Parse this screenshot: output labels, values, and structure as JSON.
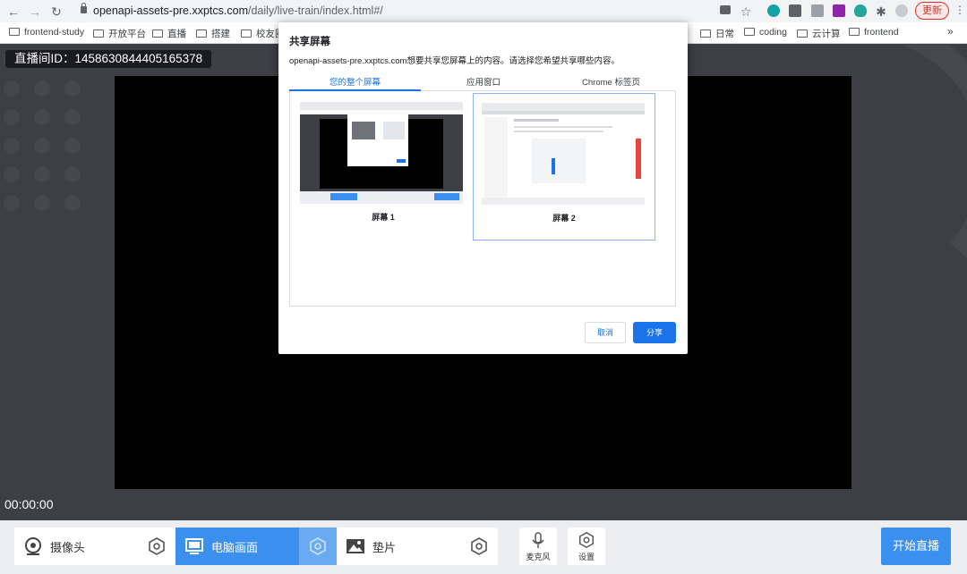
{
  "browser": {
    "url_host": "openapi-assets-pre.xxptcs.com",
    "url_path": "/daily/live-train/index.html#/",
    "update_label": "更新",
    "menu_glyph": "⋮"
  },
  "bookmarks": [
    {
      "label": "frontend-study"
    },
    {
      "label": "开放平台"
    },
    {
      "label": "直播"
    },
    {
      "label": "搭建"
    },
    {
      "label": "校友圈"
    },
    {
      "label": "日常"
    },
    {
      "label": "coding"
    },
    {
      "label": "云计算"
    },
    {
      "label": "frontend"
    }
  ],
  "bookmarks_overflow": "»",
  "page": {
    "room_id": "直播间ID：1458630844405165378",
    "timer": "00:00:00"
  },
  "controls": {
    "camera_label": "摄像头",
    "screen_label": "电脑画面",
    "slide_label": "垫片",
    "mic_label": "麦克风",
    "settings_label": "设置",
    "golive_label": "开始直播"
  },
  "dialog": {
    "title": "共享屏幕",
    "description": "openapi-assets-pre.xxptcs.com想要共享您屏幕上的内容。请选择您希望共享哪些内容。",
    "tabs": [
      {
        "label": "您的整个屏幕"
      },
      {
        "label": "应用窗口"
      },
      {
        "label": "Chrome 标签页"
      }
    ],
    "screens": [
      {
        "label": "屏幕 1"
      },
      {
        "label": "屏幕 2"
      }
    ],
    "cancel_label": "取消",
    "share_label": "分享"
  },
  "colors": {
    "accent": "#3a8fef",
    "chrome_blue": "#1a73e8",
    "page_bg": "#3d3f44"
  }
}
